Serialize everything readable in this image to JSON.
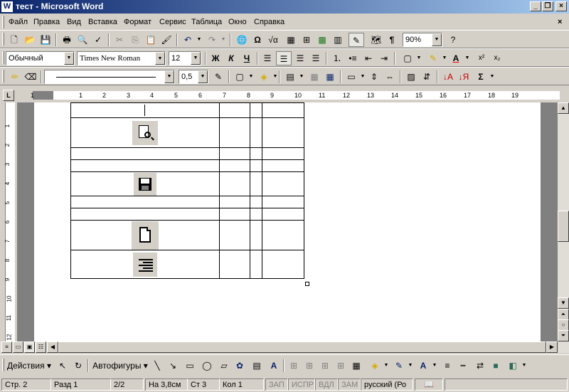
{
  "window": {
    "title": "тест - Microsoft Word",
    "app_icon": "W",
    "minimize": "_",
    "restore": "❐",
    "close": "×"
  },
  "menu": [
    "Файл",
    "Правка",
    "Вид",
    "Вставка",
    "Формат",
    "Сервис",
    "Таблица",
    "Окно",
    "Справка"
  ],
  "menu_close": "×",
  "standard_toolbar": {
    "zoom": "90%"
  },
  "formatting_toolbar": {
    "style": "Обычный",
    "font": "Times New Roman",
    "size": "12",
    "bold": "Ж",
    "italic": "К",
    "underline": "Ч"
  },
  "tables_toolbar": {
    "line_weight": "0,5"
  },
  "ruler_numbers": [
    "1",
    "1",
    "2",
    "3",
    "4",
    "5",
    "6",
    "7",
    "8",
    "9",
    "10",
    "11",
    "12",
    "13",
    "14",
    "15",
    "16",
    "17",
    "18",
    "19"
  ],
  "vruler_numbers": [
    "1",
    "2",
    "3",
    "4",
    "5",
    "6",
    "7",
    "8",
    "9",
    "10",
    "11",
    "12"
  ],
  "drawing_toolbar": {
    "actions": "Действия",
    "autoshapes": "Автофигуры"
  },
  "status": {
    "page": "Стр. 2",
    "section": "Разд 1",
    "pages": "2/2",
    "at": "На 3,8см",
    "line": "Ст 3",
    "col": "Кол 1",
    "rec": "ЗАП",
    "trk": "ИСПР",
    "ext": "ВДЛ",
    "ovr": "ЗАМ",
    "lang": "русский (Ро"
  },
  "table_icons": [
    "print-preview-icon",
    "save-icon",
    "new-document-icon",
    "align-right-icon"
  ]
}
